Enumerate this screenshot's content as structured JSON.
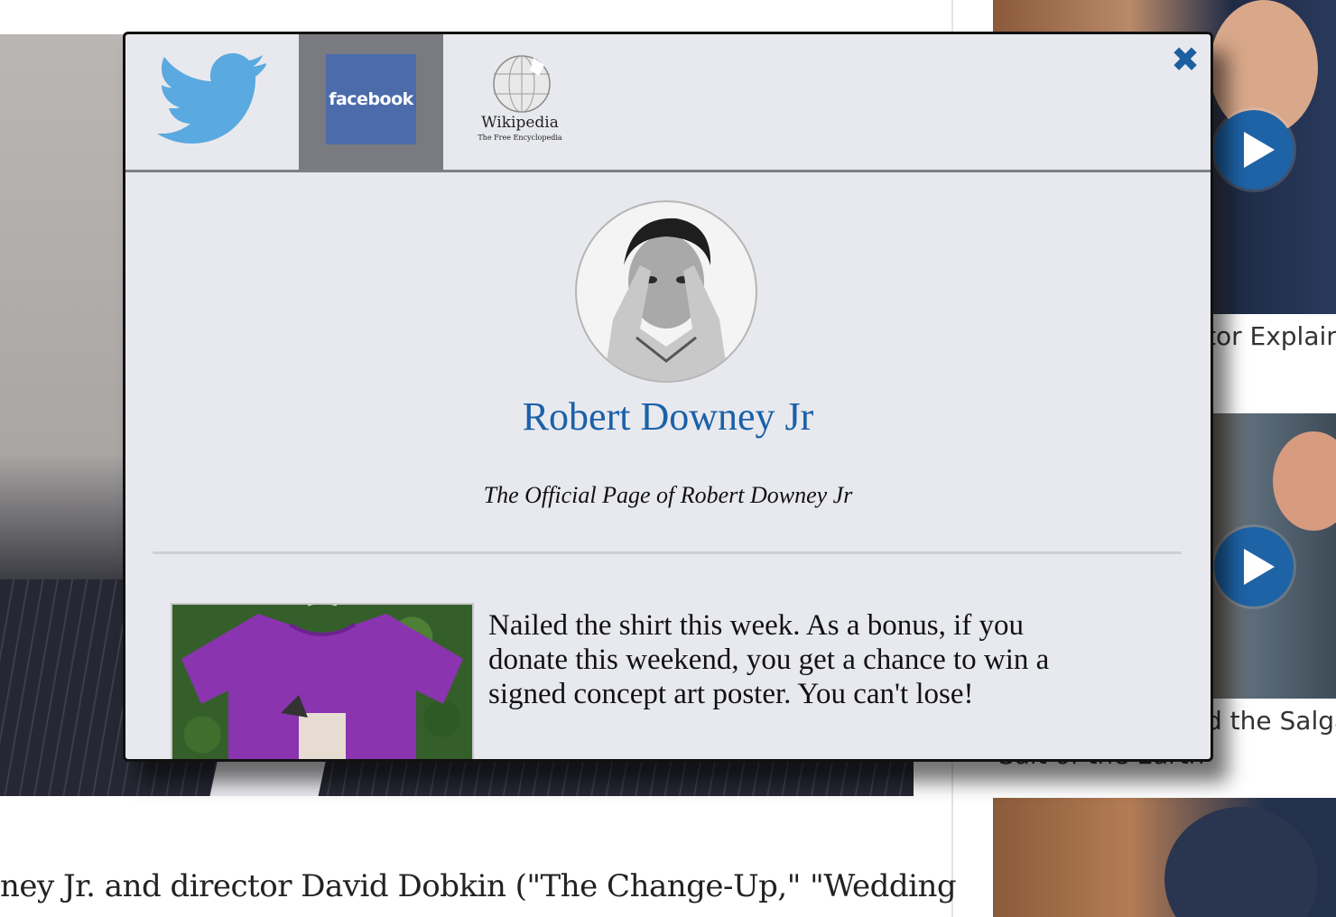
{
  "background": {
    "article_text": "ney Jr. and director David Dobkin (\"The Change-Up,\" \"Wedding",
    "sidebar_videos": [
      {
        "title": "tor Explain"
      },
      {
        "title": "d the Salga",
        "subtitle": "Salt of the Earth"
      },
      {
        "title": ""
      }
    ]
  },
  "modal": {
    "tabs": [
      {
        "name": "Twitter",
        "icon": "twitter-bird-icon"
      },
      {
        "name": "facebook",
        "icon": "facebook-logo",
        "active": true
      },
      {
        "name": "Wikipedia",
        "wordmark": "Wikipedia",
        "tagline": "The Free Encyclopedia",
        "icon": "wikipedia-globe-icon"
      }
    ],
    "close_icon": "✖",
    "profile": {
      "name": "Robert Downey Jr",
      "description": "The Official Page of Robert Downey Jr"
    },
    "post": {
      "text": "Nailed the shirt this week. As a bonus, if you donate this weekend, you get a chance to win a signed concept art poster. You can't lose!"
    },
    "colors": {
      "accent": "#1a61a8",
      "facebook_blue": "#4b6bab",
      "twitter_blue": "#5aa9e0",
      "modal_bg": "#e8e9ee",
      "active_tab_bg": "#797b80"
    }
  }
}
